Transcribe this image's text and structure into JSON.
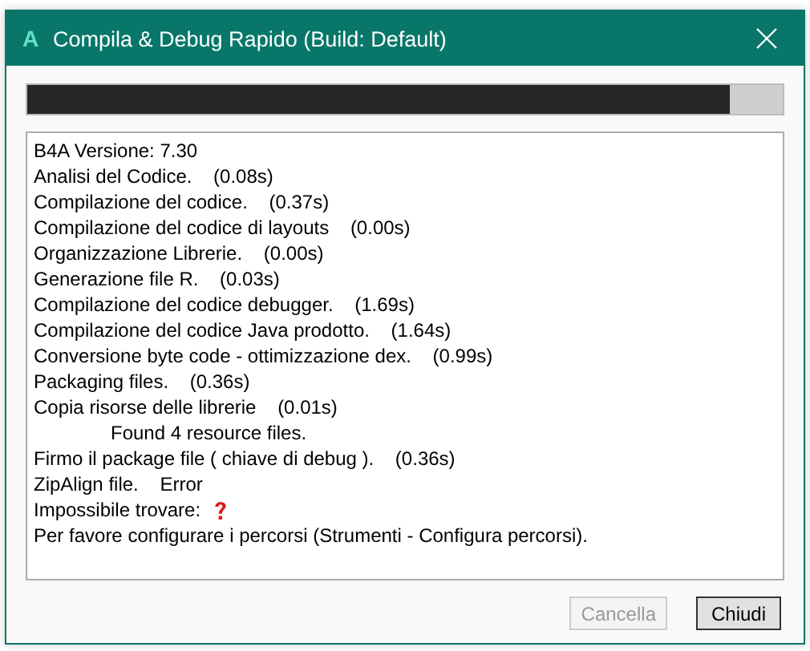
{
  "window": {
    "title": "Compila & Debug Rapido (Build: Default)",
    "app_letter": "A"
  },
  "progress": {
    "level": 0.93
  },
  "log": [
    {
      "text": "B4A Versione: 7.30",
      "kind": "text",
      "indented": false
    },
    {
      "text": "Analisi del Codice.    (0.08s)",
      "kind": "text",
      "indented": false
    },
    {
      "text": "Compilazione del codice.    (0.37s)",
      "kind": "text",
      "indented": false
    },
    {
      "text": "Compilazione del codice di layouts    (0.00s)",
      "kind": "text",
      "indented": false
    },
    {
      "text": "Organizzazione Librerie.    (0.00s)",
      "kind": "text",
      "indented": false
    },
    {
      "text": "Generazione file R.    (0.03s)",
      "kind": "text",
      "indented": false
    },
    {
      "text": "Compilazione del codice debugger.    (1.69s)",
      "kind": "text",
      "indented": false
    },
    {
      "text": "Compilazione del codice Java prodotto.    (1.64s)",
      "kind": "text",
      "indented": false
    },
    {
      "text": "Conversione byte code - ottimizzazione dex.    (0.99s)",
      "kind": "text",
      "indented": false
    },
    {
      "text": "Packaging files.    (0.36s)",
      "kind": "text",
      "indented": false
    },
    {
      "text": "Copia risorse delle librerie    (0.01s)",
      "kind": "text",
      "indented": false
    },
    {
      "text": "Found 4 resource files.",
      "kind": "text",
      "indented": true
    },
    {
      "text": "Firmo il package file ( chiave di debug ).    (0.36s)",
      "kind": "text",
      "indented": false
    },
    {
      "text": "ZipAlign file.    Error",
      "kind": "text",
      "indented": false
    },
    {
      "text": "Impossibile trovare:",
      "kind": "missing",
      "indented": false
    },
    {
      "text": "Per favore configurare i percorsi (Strumenti - Configura percorsi).",
      "kind": "text",
      "indented": false
    }
  ],
  "buttons": [
    {
      "label": "Cancella",
      "disabled": true
    },
    {
      "label": "Chiudi",
      "disabled": false
    }
  ]
}
